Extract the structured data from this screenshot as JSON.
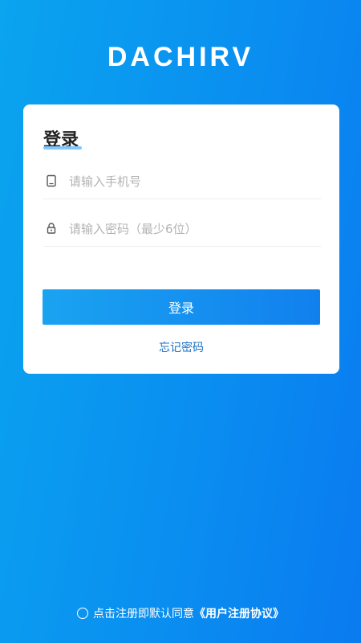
{
  "brand": {
    "logo_text": "DACHIRV"
  },
  "login": {
    "title": "登录",
    "phone_placeholder": "请输入手机号",
    "password_placeholder": "请输入密码（最少6位）",
    "submit_label": "登录",
    "forgot_label": "忘记密码"
  },
  "agreement": {
    "prefix": "点击注册即默认同意",
    "link_text": "《用户注册协议》"
  },
  "icons": {
    "phone": "tablet-phone-icon",
    "password": "lock-icon",
    "agree": "radio-circle-icon"
  },
  "colors": {
    "background_start": "#0aa4ef",
    "background_end": "#0a7bf0",
    "button": "#1180ee",
    "forgot_link": "#1a6fc2"
  }
}
